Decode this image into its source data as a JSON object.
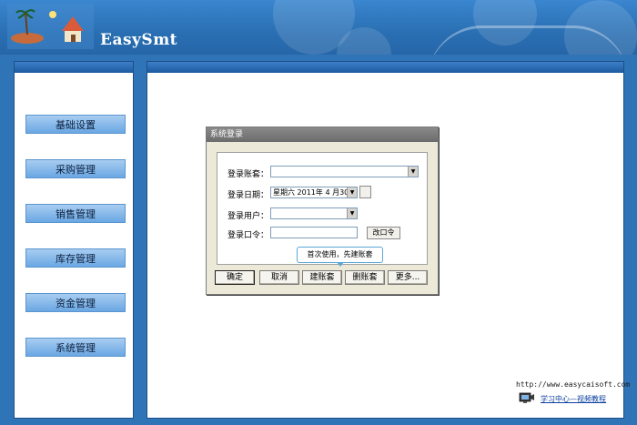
{
  "header": {
    "app_title": "EasySmt"
  },
  "sidebar": {
    "items": [
      {
        "label": "基础设置"
      },
      {
        "label": "采购管理"
      },
      {
        "label": "销售管理"
      },
      {
        "label": "库存管理"
      },
      {
        "label": "资金管理"
      },
      {
        "label": "系统管理"
      }
    ]
  },
  "login_dialog": {
    "title": "系统登录",
    "account_label": "登录账套：",
    "account_value": "",
    "date_label": "登录日期：",
    "date_value": "星期六 2011年 4 月30",
    "user_label": "登录用户：",
    "user_value": "",
    "password_label": "登录口令：",
    "password_value": "",
    "change_password_label": "改口令",
    "tooltip": "首次使用，先建账套",
    "buttons": {
      "ok": "确定",
      "cancel": "取消",
      "create_account_set": "建账套",
      "delete_account_set": "删账套",
      "more": "更多..."
    }
  },
  "footer": {
    "url": "http://www.easycaisoft.com",
    "video_link": "学习中心—视频教程"
  }
}
